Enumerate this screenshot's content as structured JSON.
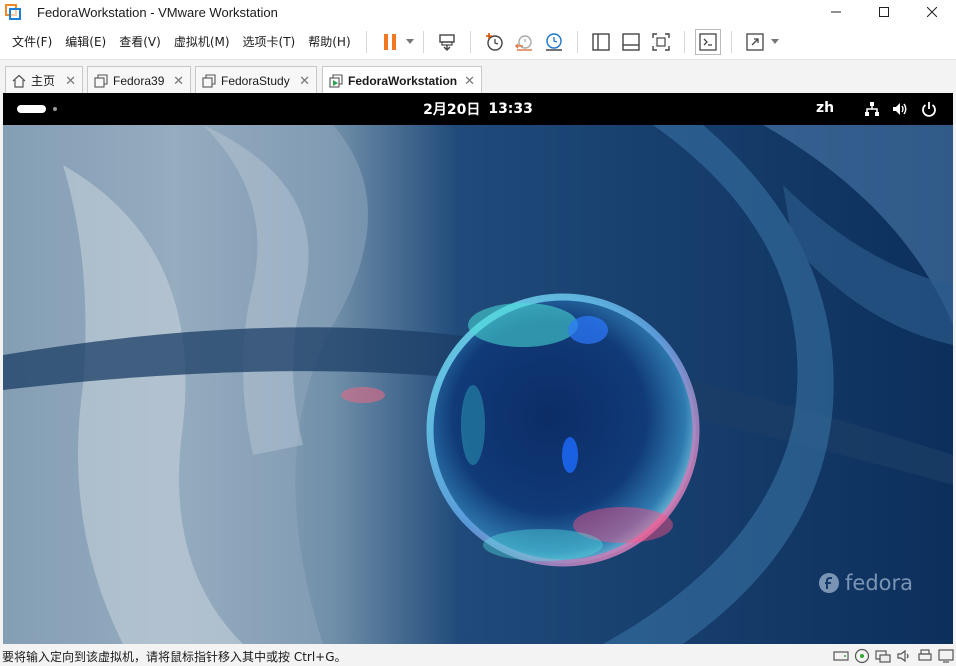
{
  "window": {
    "title": "FedoraWorkstation - VMware Workstation",
    "minimize": "—",
    "maximize": "☐",
    "close": "✕"
  },
  "menu": {
    "file": "文件(F)",
    "edit": "编辑(E)",
    "view": "查看(V)",
    "vm": "虚拟机(M)",
    "tabs": "选项卡(T)",
    "help": "帮助(H)"
  },
  "toolbar": {
    "icons": [
      "pause-icon",
      "send-keys-icon",
      "snapshot-icon",
      "revert-snapshot-icon",
      "snapshot-manager-icon",
      "show-library-icon",
      "thumbnail-bar-icon",
      "fit-guest-icon",
      "console-view-icon",
      "fullscreen-icon"
    ],
    "accent": "#f07820"
  },
  "tabs": [
    {
      "label": "主页",
      "icon": "home-icon",
      "active": false
    },
    {
      "label": "Fedora39",
      "icon": "vm-icon",
      "active": false
    },
    {
      "label": "FedoraStudy",
      "icon": "vm-icon",
      "active": false
    },
    {
      "label": "FedoraWorkstation",
      "icon": "vm-running-icon",
      "active": true
    }
  ],
  "guest": {
    "date": "2月20日",
    "time": "13:33",
    "lang": "zh",
    "watermark": "fedora",
    "topbar_color": "#000000"
  },
  "status": {
    "message": "要将输入定向到该虚拟机，请将鼠标指针移入其中或按 Ctrl+G。",
    "icons": [
      "hdd-icon",
      "cd-icon",
      "network-icon",
      "sound-icon",
      "printer-icon",
      "display-icon"
    ]
  }
}
